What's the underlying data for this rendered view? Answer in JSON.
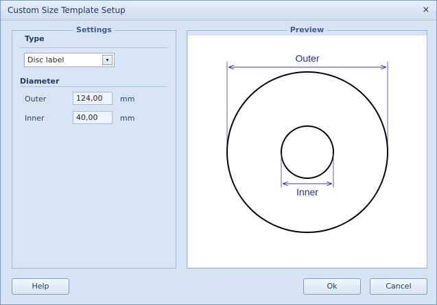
{
  "window": {
    "title": "Custom Size Template Setup",
    "close_glyph": "×"
  },
  "settings": {
    "legend": "Settings",
    "type_heading": "Type",
    "type_value": "Disc label",
    "dropdown_glyph": "▾",
    "diameter_heading": "Diameter",
    "outer_label": "Outer",
    "outer_value": "124,00",
    "inner_label": "Inner",
    "inner_value": "40,00",
    "unit": "mm"
  },
  "preview": {
    "legend": "Preview",
    "outer_label": "Outer",
    "inner_label": "Inner",
    "line_color": "#3a3ab0",
    "circle_color": "#000000",
    "outer_diameter_mm": 124,
    "inner_diameter_mm": 40
  },
  "buttons": {
    "help": "Help",
    "ok": "Ok",
    "cancel": "Cancel"
  }
}
